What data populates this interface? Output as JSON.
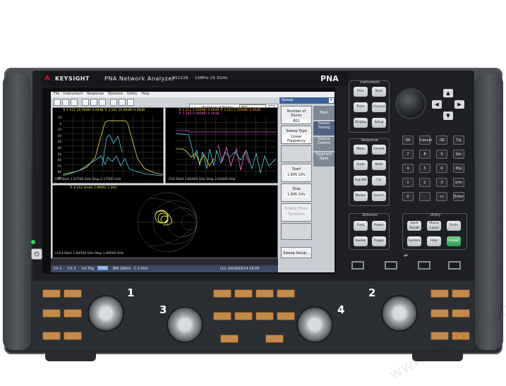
{
  "brand": {
    "maker": "KEYSIGHT",
    "model": "PNA Network Analyzer",
    "model_no": "N5222B",
    "range": "10MHz-26.5GHz",
    "badge": "PNA"
  },
  "menu": [
    "File",
    "Instrument",
    "Response",
    "Stimulus",
    "Utility",
    "Help"
  ],
  "toolbar": {
    "field_label": "Number of Points",
    "field_value": "801"
  },
  "traces": {
    "tl_header": "Tr 1  S21 10.00dB/  0.00dB  Tr 2  S41 10.00dB/  0.00dB",
    "tl_footer": "Ch1  Start  1.67500 GHz            Stop  2.17500 GHz",
    "tr_header": "Tr 3  S11 5.000dB/ 0.00dB  Tr 4  S22 5.000dB/ 0.00dB",
    "tr_header2": "Tr 5  S44 5.000dB/ 0.00dB",
    "tr_footer": "Ch2  Start  1.82000 GHz            Stop  2.02000 GHz",
    "smith_header": "Tr 6  S11 Smith 1.000U/ 1.00U",
    "smith_footer": ">Ch3  Start  1.84500 GHz                                 Stop  1.89500 GHz",
    "yticks": [
      "10",
      "0",
      "-10",
      "-20",
      "-30",
      "-40",
      "-50",
      "-60",
      "-70",
      "-80",
      "-90"
    ]
  },
  "sidepanel": {
    "title": "Sweep",
    "softkeys": [
      {
        "label": "Number of Points",
        "sub": "801"
      },
      {
        "label": "Sweep Type",
        "sub": "Linear Frequency"
      },
      {
        "label": "Start",
        "sub": "1.845 GHz"
      },
      {
        "label": "Stop",
        "sub": "1.895 GHz"
      },
      {
        "label": "Enable Timer",
        "sub": "Time/Arm"
      },
      {
        "label": "Sweep Setup...",
        "sub": ""
      }
    ],
    "tabs": [
      "Main",
      "Sweep Timing",
      "Source Control",
      "Segment Table"
    ]
  },
  "statusbar": {
    "items": [
      "Ch 1",
      "Ch 3",
      "Int Trig",
      "Hold",
      "BW 10kHz",
      "C  1-Port"
    ],
    "right": "LCL   2019/03/14 16:09"
  },
  "keypad": {
    "instrument": {
      "label": "Instrument",
      "keys": [
        "Prev",
        "Next",
        "Trace",
        "Channel",
        "Display",
        "Setup"
      ]
    },
    "response": {
      "label": "Response",
      "keys": [
        "Meas",
        "Format",
        "Scale",
        "Math",
        "Avg BW",
        "Cal",
        "Marker",
        "Search"
      ]
    },
    "stimulus": {
      "label": "Stimulus",
      "keys": [
        "Freq",
        "Power",
        "Sweep",
        "Trigger"
      ]
    },
    "utility": {
      "label": "Utility",
      "keys": [
        "Save Recall",
        "Macro Local",
        "Undo",
        "System",
        "Help",
        "Preset"
      ]
    },
    "numeric": [
      "OK",
      "Cancel",
      "⌫",
      "T/p",
      "7",
      "8",
      "9",
      "G/n",
      "4",
      "5",
      "6",
      "M/μ",
      "1",
      "2",
      "3",
      "k/m",
      "0",
      ".",
      "+/-",
      "Enter"
    ]
  },
  "ports": {
    "labels": [
      "1",
      "2",
      "3",
      "4"
    ]
  },
  "watermark": "www.chem17.com"
}
